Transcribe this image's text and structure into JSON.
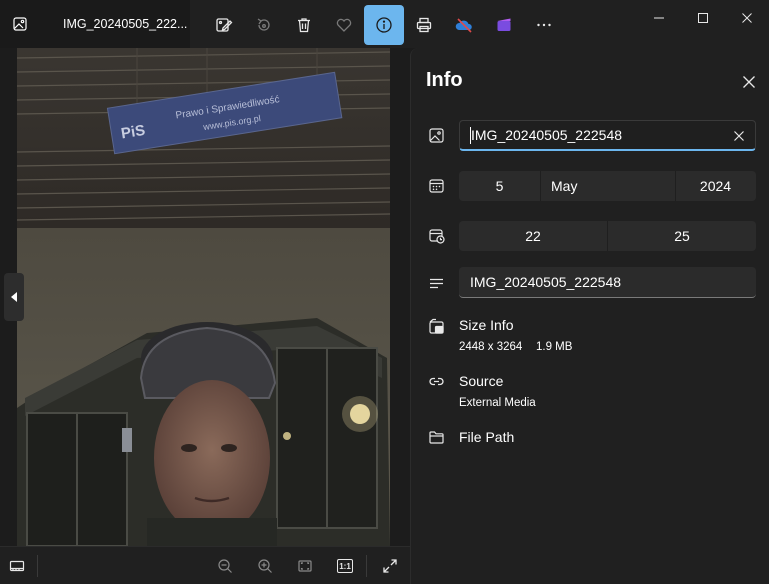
{
  "window": {
    "file_name": "IMG_20240505_222...",
    "app_icon": "photo-icon"
  },
  "toolbar": {
    "buttons": [
      {
        "name": "edit-image-icon"
      },
      {
        "name": "rotate-icon"
      },
      {
        "name": "delete-icon"
      },
      {
        "name": "favorite-icon"
      },
      {
        "name": "info-icon",
        "active": true
      },
      {
        "name": "print-icon"
      },
      {
        "name": "onedrive-icon"
      },
      {
        "name": "clipchamp-icon"
      },
      {
        "name": "more-icon"
      }
    ],
    "active_color": "#6cb6ee"
  },
  "window_controls": [
    "minimize-icon",
    "maximize-icon",
    "close-icon"
  ],
  "photo": {
    "banner_line1": "Prawo i Sprawiedliwość",
    "banner_line2": "www.pis.org.pl",
    "banner_logo": "PiS"
  },
  "bottom_bar": {
    "buttons": [
      "filmstrip-icon",
      "zoom-out-icon",
      "zoom-in-icon",
      "fit-icon",
      "actual-size-icon",
      "fullscreen-icon"
    ],
    "actual_size_label": "1:1"
  },
  "info": {
    "title": "Info",
    "name_value": "IMG_20240505_222548",
    "date": {
      "day": "5",
      "month": "May",
      "year": "2024"
    },
    "time": {
      "hour": "22",
      "minute": "25"
    },
    "caption_value": "IMG_20240505_222548",
    "size_label": "Size Info",
    "dimensions": "2448 x 3264",
    "file_size": "1.9 MB",
    "source_label": "Source",
    "source_value": "External Media",
    "file_path_label": "File Path"
  }
}
